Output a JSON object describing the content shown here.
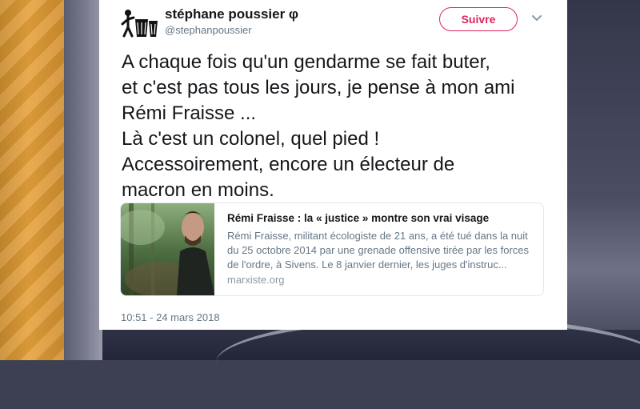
{
  "tweet": {
    "author_name": "stéphane poussier φ",
    "author_handle": "@stephanpoussier",
    "follow_label": "Suivre",
    "text": "A chaque fois qu'un gendarme se fait buter,\net c'est pas tous les jours, je pense à mon ami\nRémi Fraisse ...\nLà c'est un colonel, quel pied !\nAccessoirement, encore un électeur de\nmacron en moins.",
    "timestamp": "10:51 - 24 mars 2018"
  },
  "link_card": {
    "title": "Rémi Fraisse : la « justice » montre son vrai visage",
    "description": "Rémi Fraisse, militant écologiste de 21 ans, a été tué dans la nuit\ndu 25 octobre 2014 par une grenade offensive tirée par les forces\nde l'ordre, à Sivens. Le 8 janvier dernier, les juges d'instruc...",
    "domain": "marxiste.org"
  },
  "icons": {
    "avatar": "recycling-figure-avatar",
    "caret": "chevron-down-icon"
  },
  "colors": {
    "follow_accent": "#e0245e",
    "text_primary": "#14171a",
    "text_secondary": "#657786"
  }
}
